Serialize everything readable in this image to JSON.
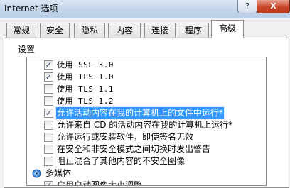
{
  "window": {
    "title": "Internet 选项",
    "help_label": "?",
    "close_label": "X"
  },
  "tabs": [
    {
      "label": "常规"
    },
    {
      "label": "安全"
    },
    {
      "label": "隐私"
    },
    {
      "label": "内容"
    },
    {
      "label": "连接"
    },
    {
      "label": "程序"
    },
    {
      "label": "高级",
      "active": true
    }
  ],
  "settings": {
    "section_label": "设置",
    "items": [
      {
        "label": "使用 SSL 3.0",
        "checked": true
      },
      {
        "label": "使用 TLS 1.0",
        "checked": true
      },
      {
        "label": "使用 TLS 1.1",
        "checked": false
      },
      {
        "label": "使用 TLS 1.2",
        "checked": false
      },
      {
        "label": "允许活动内容在我的计算机上的文件中运行*",
        "checked": true,
        "selected": true
      },
      {
        "label": "允许来自 CD 的活动内容在我的计算机上运行*",
        "checked": false
      },
      {
        "label": "允许运行或安装软件，即使签名无效",
        "checked": false
      },
      {
        "label": "在安全和非安全模式之间切换时发出警告",
        "checked": false
      },
      {
        "label": "阻止混合了其他内容的不安全图像",
        "checked": false
      }
    ],
    "category": {
      "label": "多媒体",
      "icon": "multimedia-icon"
    },
    "partial_item": {
      "label": "启用自动图像大小调整",
      "checked": true
    }
  },
  "check_glyph": "✓",
  "scroll": {
    "up_glyph": "▲",
    "down_glyph": "▼"
  }
}
